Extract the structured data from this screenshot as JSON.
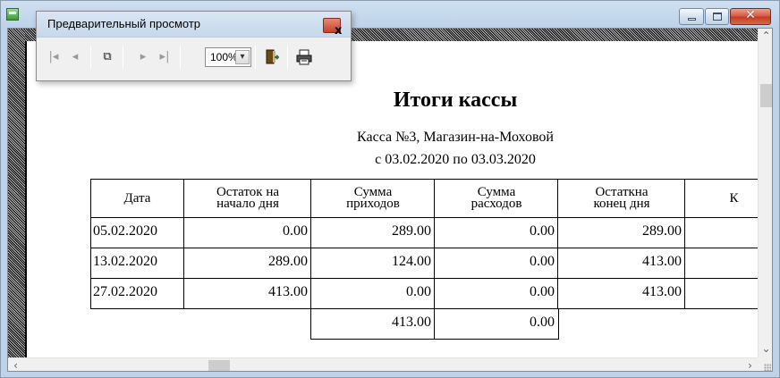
{
  "toolbar": {
    "title": "Предварительный просмотр",
    "close_glyph": "x",
    "zoom_value": "100%",
    "icons": [
      "first-page-icon",
      "previous-page-icon",
      "multi-page-icon",
      "next-page-icon",
      "last-page-icon",
      "exit-icon",
      "print-icon"
    ]
  },
  "report": {
    "title": "Итоги кассы",
    "subtitle1": "Касса №3, Магазин-на-Моховой",
    "subtitle2": "с 03.02.2020 по 03.03.2020",
    "headers": [
      "Дата",
      "Остаток на\nначало дня",
      "Сумма\nприходов",
      "Сумма\nрасходов",
      "Остаткна\nконец дня",
      "К"
    ],
    "rows": [
      [
        "05.02.2020",
        "0.00",
        "289.00",
        "0.00",
        "289.00"
      ],
      [
        "13.02.2020",
        "289.00",
        "124.00",
        "0.00",
        "413.00"
      ],
      [
        "27.02.2020",
        "413.00",
        "0.00",
        "0.00",
        "413.00"
      ]
    ],
    "totals": [
      "413.00",
      "0.00"
    ]
  },
  "colors": {
    "title_bar": "#bed3ea",
    "close_button": "#c23a22",
    "hatch": "#bdbdbd"
  }
}
